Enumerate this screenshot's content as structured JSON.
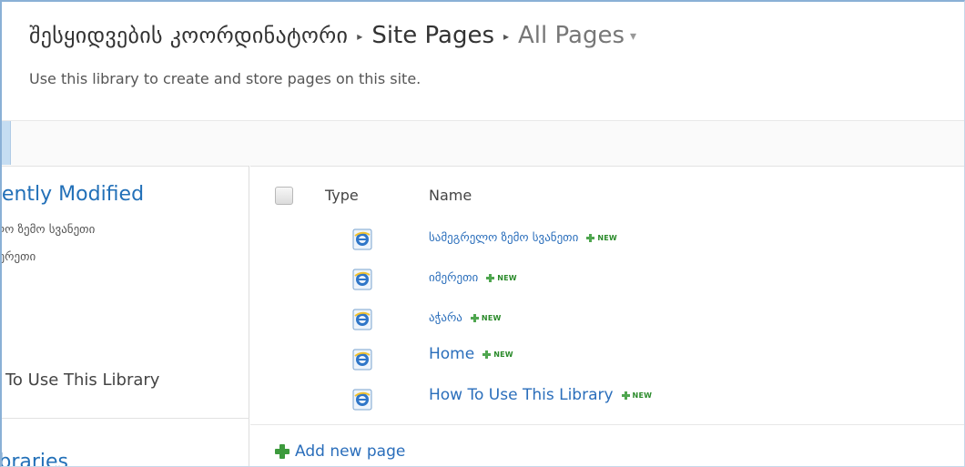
{
  "breadcrumb": {
    "site": "შესყიდვების კოორდინატორი",
    "library": "Site Pages",
    "view": "All Pages",
    "separator": "▸",
    "view_caret": "▾"
  },
  "description": "Use this library to create and store pages on this site.",
  "leftnav": {
    "heading": "Recently Modified",
    "items": [
      "სამეგრელო ზემო სვანეთი",
      "იმერეთი",
      "How To Use This Library"
    ],
    "heading2": "Libraries"
  },
  "list": {
    "columns": {
      "type": "Type",
      "name": "Name"
    },
    "rows": [
      {
        "name": "სამეგრელო ზემო სვანეთი",
        "icon": "ie-page-icon",
        "badge": "NEW"
      },
      {
        "name": "იმერეთი",
        "icon": "ie-page-icon",
        "badge": "NEW"
      },
      {
        "name": "აჭარა",
        "icon": "ie-page-icon",
        "badge": "NEW"
      },
      {
        "name": "Home",
        "icon": "ie-page-icon",
        "badge": "NEW"
      },
      {
        "name": "How To Use This Library",
        "icon": "ie-page-icon",
        "badge": "NEW"
      }
    ],
    "add_new_label": "Add new page"
  },
  "colors": {
    "link": "#2a6ebb",
    "heading_blue": "#2270b8",
    "new_badge": "#2a8a2a",
    "add_plus": "#3d9a3d",
    "frame_border": "#8ab0d6"
  }
}
